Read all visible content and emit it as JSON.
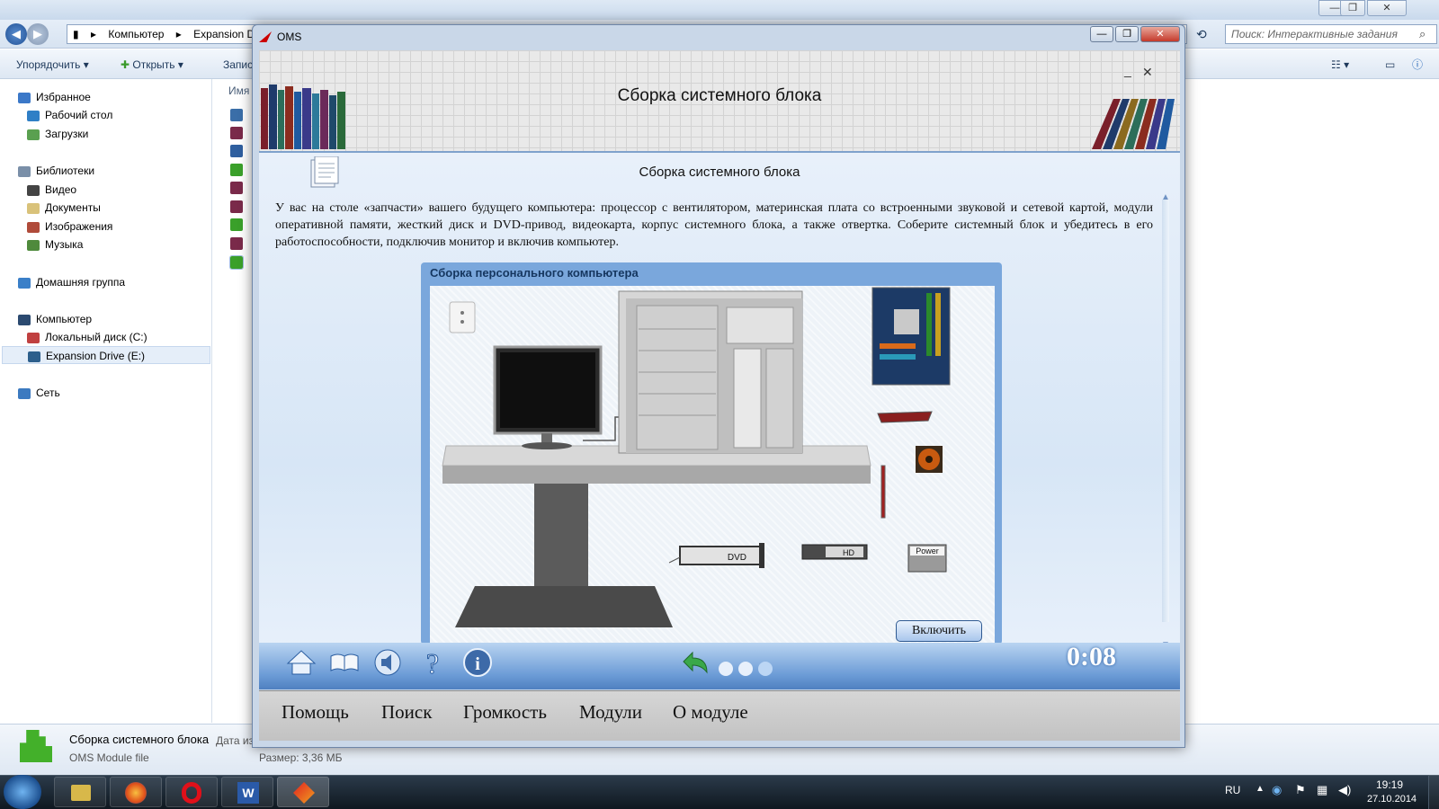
{
  "explorer": {
    "breadcrumb": [
      "Компьютер",
      "Expansion Drive"
    ],
    "search_placeholder": "Поиск: Интерактивные задания",
    "toolbar": {
      "organize": "Упорядочить",
      "open": "Открыть",
      "record": "Запис"
    },
    "column_name": "Имя",
    "nav": [
      {
        "label": "Избранное",
        "group": true
      },
      {
        "label": "Рабочий стол"
      },
      {
        "label": "Загрузки"
      },
      {
        "label": "Библиотеки",
        "group": true
      },
      {
        "label": "Видео"
      },
      {
        "label": "Документы"
      },
      {
        "label": "Изображения"
      },
      {
        "label": "Музыка"
      },
      {
        "label": "Домашняя группа",
        "group": true
      },
      {
        "label": "Компьютер",
        "group": true
      },
      {
        "label": "Локальный диск (C:)"
      },
      {
        "label": "Expansion Drive (E:)",
        "selected": true
      },
      {
        "label": "Сеть",
        "group": true
      }
    ],
    "details": {
      "file_name": "Сборка системного блока",
      "date_label": "Дата из",
      "file_type": "OMS Module file",
      "size": "Размер: 3,36 МБ"
    }
  },
  "oms": {
    "window_title": "OMS",
    "header_title": "Сборка системного блока",
    "lesson_title": "Сборка системного блока",
    "lesson_text": "У вас на столе «запчасти» вашего будущего компьютера: процессор с вентилятором, материнская плата со встроенными звуковой и сетевой картой, модули оперативной памяти, жесткий диск и DVD-привод, видеокарта, корпус системного блока, а также отвертка. Соберите системный блок и убедитесь в его работоспособности, подключив монитор и включив компьютер.",
    "simulation_title": "Сборка персонального компьютера",
    "power_button": "Включить",
    "parts": {
      "dvd": "DVD",
      "hd": "HD",
      "power": "Power"
    },
    "timer": "0:08",
    "menu": [
      "Помощь",
      "Поиск",
      "Громкость",
      "Модули",
      "О модуле"
    ]
  },
  "taskbar": {
    "lang": "RU",
    "time": "19:19",
    "date": "27.10.2014"
  },
  "colors": {
    "accent": "#4f80c0",
    "menu_bg": "#c8c8c8",
    "taskbar": "#1a2530"
  }
}
